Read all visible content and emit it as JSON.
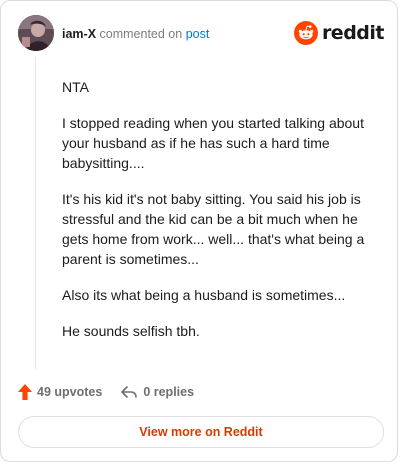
{
  "header": {
    "username": "iam-X",
    "verb": "commented on",
    "post_link": "post",
    "brand": "reddit"
  },
  "comment": {
    "paragraphs": [
      "NTA",
      "I stopped reading when you started talking about your husband as if he has such a hard time babysitting....",
      "It's his kid it's not baby sitting. You said his job is stressful and the kid can be a bit much when he gets home from work... well... that's what being a parent is sometimes...",
      "Also its what being a husband is sometimes...",
      "He sounds selfish tbh."
    ]
  },
  "actions": {
    "upvotes": "49 upvotes",
    "replies": "0 replies"
  },
  "footer": {
    "view_more": "View more on Reddit"
  },
  "colors": {
    "brand": "#ff4500",
    "link": "#0079d3",
    "view_more": "#d93a00"
  },
  "icons": {
    "upvote": "arrow-up-icon",
    "reply": "reply-arrow-icon",
    "logo": "reddit-snoo-icon"
  }
}
